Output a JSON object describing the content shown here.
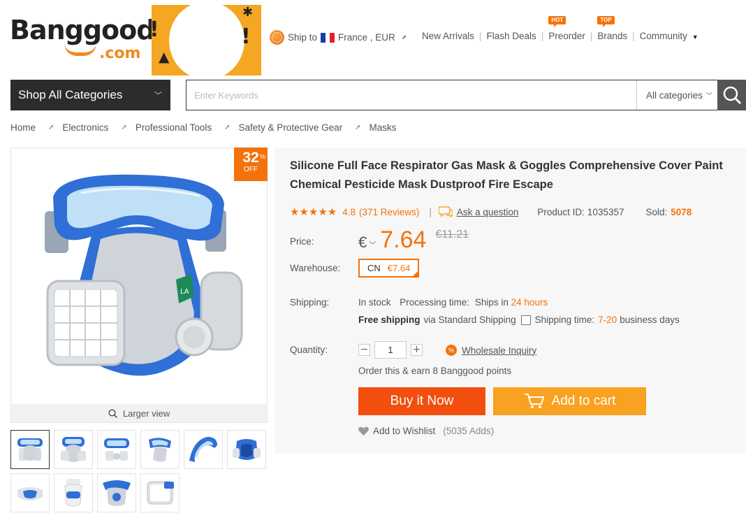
{
  "header": {
    "logo": {
      "word": "Banggood",
      "suffix": ".com"
    },
    "ship_to_label": "Ship to",
    "country_currency": "France , EUR",
    "nav": [
      {
        "label": "New Arrivals",
        "tag": ""
      },
      {
        "label": "Flash Deals",
        "tag": ""
      },
      {
        "label": "Preorder",
        "tag": "HOT"
      },
      {
        "label": "Brands",
        "tag": "TOP"
      },
      {
        "label": "Community",
        "tag": ""
      }
    ]
  },
  "search": {
    "category_button": "Shop All Categories",
    "placeholder": "Enter Keywords",
    "category_select": "All categories"
  },
  "breadcrumb": [
    "Home",
    "Electronics",
    "Professional Tools",
    "Safety & Protective Gear",
    "Masks"
  ],
  "gallery": {
    "discount_number": "32",
    "discount_percent": "%",
    "discount_off": "OFF",
    "larger_view": "Larger view",
    "thumbnail_count": 10
  },
  "product": {
    "title": "Silicone Full Face Respirator Gas Mask & Goggles Comprehensive Cover Paint Chemical Pesticide Mask Dustproof Fire Escape",
    "rating": "4.8",
    "reviews": "(371 Reviews)",
    "ask_question": "Ask a question",
    "product_id_label": "Product ID:",
    "product_id": "1035357",
    "sold_label": "Sold:",
    "sold": "5078",
    "price_label": "Price:",
    "currency_symbol": "€",
    "price": "7.64",
    "old_price": "€11.21",
    "warehouse_label": "Warehouse:",
    "warehouse_code": "CN",
    "warehouse_price": "€7.64",
    "shipping_label": "Shipping:",
    "stock": "In stock",
    "processing_label": "Processing time:",
    "ships_in": "Ships in",
    "ships_hours": "24 hours",
    "free_shipping": "Free shipping",
    "via": "via Standard Shipping",
    "shipping_time_label": "Shipping time:",
    "shipping_days": "7-20",
    "business_days": "business days",
    "quantity_label": "Quantity:",
    "quantity": "1",
    "wholesale": "Wholesale Inquiry",
    "earn_points": "Order this & earn 8 Banggood points",
    "buy_now": "Buy it Now",
    "add_to_cart": "Add to cart",
    "wishlist": "Add to Wishlist",
    "wishlist_count": "(5035 Adds)"
  },
  "colors": {
    "accent": "#f5720a",
    "buy": "#f24e0e",
    "cart": "#f9a120",
    "dark": "#2c2c2c",
    "mask_blue": "#2f6fd6"
  }
}
